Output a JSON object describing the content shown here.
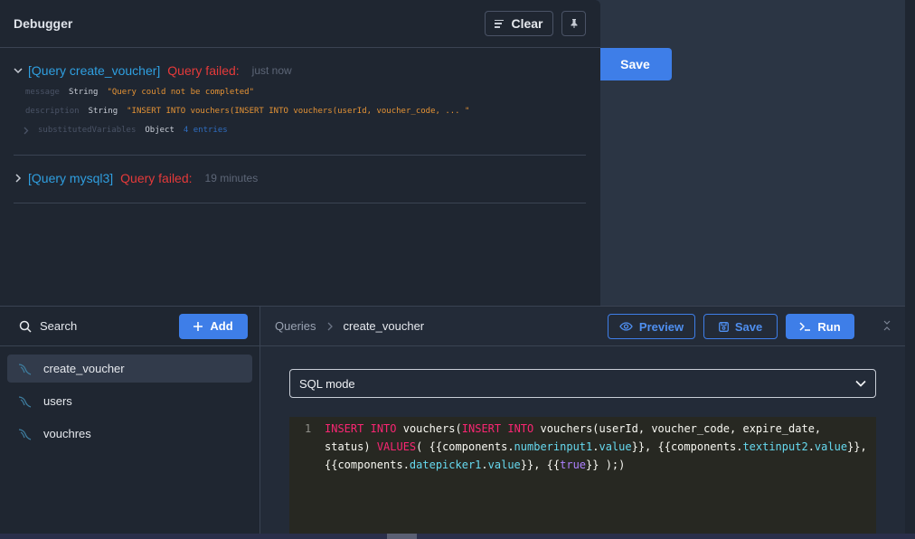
{
  "canvas": {
    "save_label": "Save"
  },
  "debugger": {
    "title": "Debugger",
    "clear_label": "Clear",
    "entries": [
      {
        "name": "[Query create_voucher]",
        "status": "Query failed:",
        "time": "just now",
        "fields": [
          {
            "key": "message",
            "type": "String",
            "value": "\"Query could not be completed\""
          },
          {
            "key": "description",
            "type": "String",
            "value": "\"INSERT INTO vouchers(INSERT INTO vouchers(userId, voucher_code, ... \""
          },
          {
            "key": "substitutedVariables",
            "type": "Object",
            "value": "4 entries"
          }
        ]
      },
      {
        "name": "[Query mysql3]",
        "status": "Query failed:",
        "time": "19 minutes"
      }
    ]
  },
  "sidebar": {
    "search_label": "Search",
    "add_label": "Add",
    "queries": [
      "create_voucher",
      "users",
      "vouchres"
    ]
  },
  "editor": {
    "breadcrumb_root": "Queries",
    "breadcrumb_current": "create_voucher",
    "preview_label": "Preview",
    "save_label": "Save",
    "run_label": "Run",
    "mode": "SQL mode",
    "line_number": "1",
    "code": {
      "kw_insert": "INSERT",
      "kw_into": "INTO",
      "t1": "vouchers(",
      "t2": "vouchers(userId, voucher_code, expire_date,",
      "t3": "status)",
      "kw_values": "VALUES",
      "t4": "( {{components.",
      "p1": "numberinput1",
      "t5": ".",
      "p2": "value",
      "t6": "}}, {{components.",
      "p3": "textinput2",
      "p4": "value",
      "t7": "}},",
      "t8": "{{components.",
      "p5": "datepicker1",
      "p6": "value",
      "t9": "}}, {{",
      "b1": "true",
      "t10": "}} );)"
    }
  },
  "colors": {
    "accent": "#3e7ee8",
    "error": "#e43a3a",
    "link": "#2f9fe0"
  }
}
